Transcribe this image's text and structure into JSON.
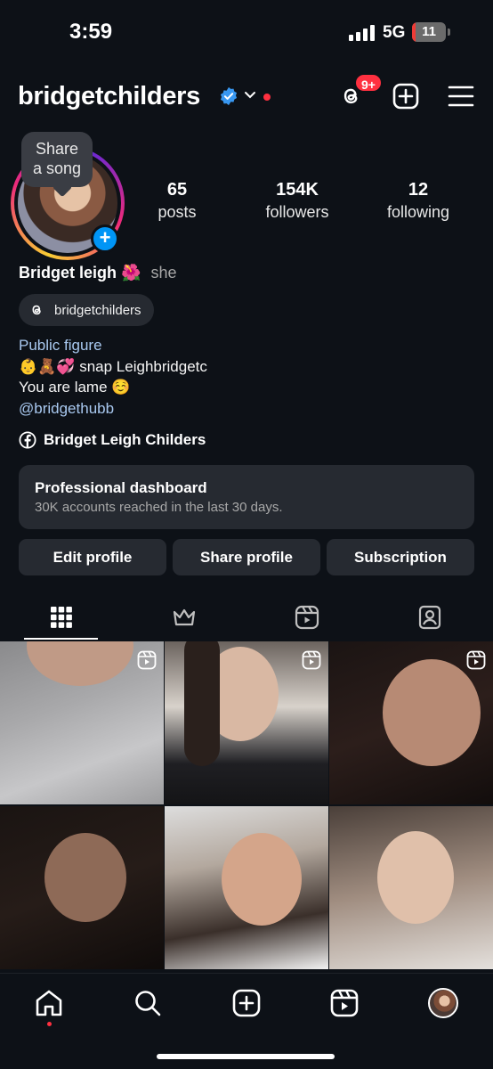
{
  "status_bar": {
    "time": "3:59",
    "network": "5G",
    "battery": "11",
    "battery_level": 0.11
  },
  "header": {
    "username": "bridgetchilders",
    "threads_badge": "9+"
  },
  "profile": {
    "song_bubble": {
      "line1": "Share",
      "line2": "a song"
    },
    "stats": [
      {
        "value": "65",
        "label": "posts"
      },
      {
        "value": "154K",
        "label": "followers"
      },
      {
        "value": "12",
        "label": "following"
      }
    ],
    "display_name": "Bridget leigh",
    "name_emoji": "🌺",
    "pronoun": "she",
    "threads_handle": "bridgetchilders",
    "category": "Public figure",
    "bio_line1": "👶🧸💞 snap Leighbridgetc",
    "bio_line2": "You are lame ☺️",
    "bio_link": "@bridgethubb",
    "facebook_link": "Bridget Leigh Childers"
  },
  "dashboard": {
    "title": "Professional dashboard",
    "subtitle": "30K accounts reached in the last 30 days."
  },
  "buttons": {
    "edit": "Edit profile",
    "share": "Share profile",
    "subscription": "Subscription"
  },
  "tabs": [
    {
      "name": "grid",
      "icon": "grid-icon",
      "active": true
    },
    {
      "name": "subscriptions",
      "icon": "crown-icon",
      "active": false
    },
    {
      "name": "reels",
      "icon": "reels-icon",
      "active": false
    },
    {
      "name": "tagged",
      "icon": "tagged-person-icon",
      "active": false
    }
  ],
  "posts": [
    {
      "type": "reel"
    },
    {
      "type": "reel"
    },
    {
      "type": "reel"
    },
    {
      "type": "photo"
    },
    {
      "type": "photo"
    },
    {
      "type": "photo"
    }
  ],
  "bottom_nav": [
    "home-icon",
    "search-icon",
    "create-icon",
    "reels-icon",
    "profile-avatar"
  ],
  "colors": {
    "background": "#0d1117",
    "accent": "#0095f6",
    "notification": "#ff3040",
    "link": "#a9c9f0",
    "surface": "#262a31"
  }
}
